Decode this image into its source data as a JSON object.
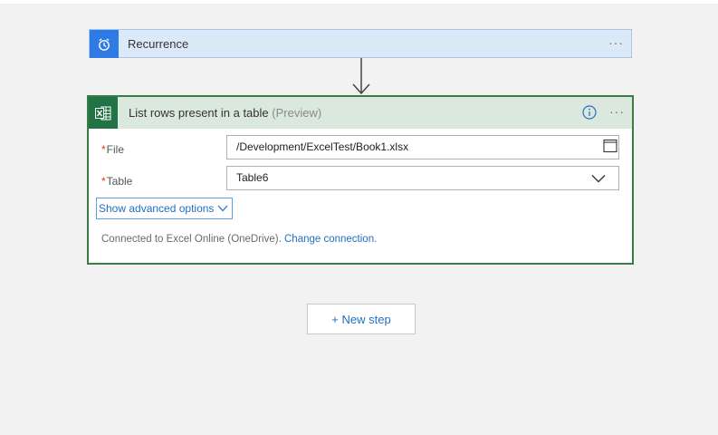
{
  "recurrence": {
    "title": "Recurrence",
    "more": "···",
    "icon": "alarm-clock-icon",
    "accent": "#2f7be5"
  },
  "excel_action": {
    "title": "List rows present in a table",
    "preview": "(Preview)",
    "more": "···",
    "icon": "excel-icon",
    "accent": "#217346",
    "info_icon": "info-icon",
    "fields": [
      {
        "label": "File",
        "required_mark": "*",
        "value": "/Development/ExcelTest/Book1.xlsx",
        "icon": "file-picker-icon"
      },
      {
        "label": "Table",
        "required_mark": "*",
        "value": "Table6",
        "icon": "chevron-down-icon"
      }
    ],
    "advanced_options": "Show advanced options",
    "connection_text": "Connected to Excel Online (OneDrive).",
    "change_connection": "Change connection."
  },
  "new_step": {
    "label": "+ New step"
  }
}
